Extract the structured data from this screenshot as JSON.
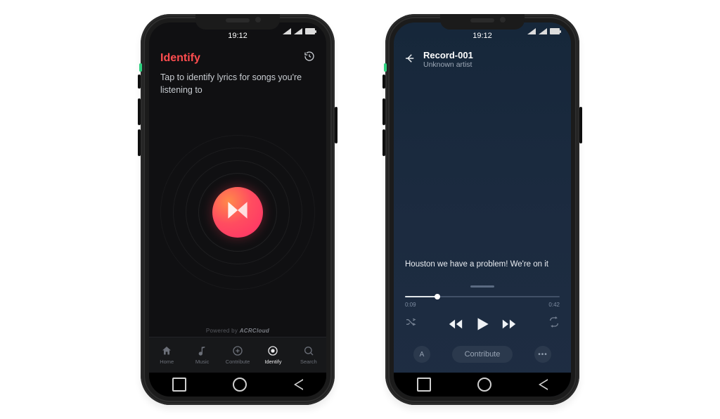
{
  "statusbar": {
    "time": "19:12"
  },
  "screen1": {
    "title": "Identify",
    "subtitle": "Tap to identify lyrics for songs you're listening to",
    "powered_prefix": "Powered by",
    "powered_brand": "ACRCloud",
    "icons": {
      "history": "history-icon",
      "identify": "musixmatch-logo"
    },
    "nav": {
      "items": [
        {
          "label": "Home",
          "icon": "home-icon",
          "active": false
        },
        {
          "label": "Music",
          "icon": "music-note-icon",
          "active": false
        },
        {
          "label": "Contribute",
          "icon": "plus-circle-icon",
          "active": false
        },
        {
          "label": "Identify",
          "icon": "target-icon",
          "active": true
        },
        {
          "label": "Search",
          "icon": "search-icon",
          "active": false
        }
      ]
    }
  },
  "screen2": {
    "track_title": "Record-001",
    "artist": "Unknown artist",
    "message": "Houston we have a problem! We're on it",
    "progress": {
      "elapsed": "0:09",
      "total": "0:42",
      "percent": 21
    },
    "controls": {
      "shuffle": "shuffle-icon",
      "prev": "previous-icon",
      "play": "play-icon",
      "next": "next-icon",
      "repeat": "repeat-icon"
    },
    "bottom": {
      "font_chip": "A",
      "contribute": "Contribute",
      "more": "•••"
    }
  },
  "android_nav": {
    "recent": "recent-apps",
    "home": "home",
    "back": "back"
  }
}
